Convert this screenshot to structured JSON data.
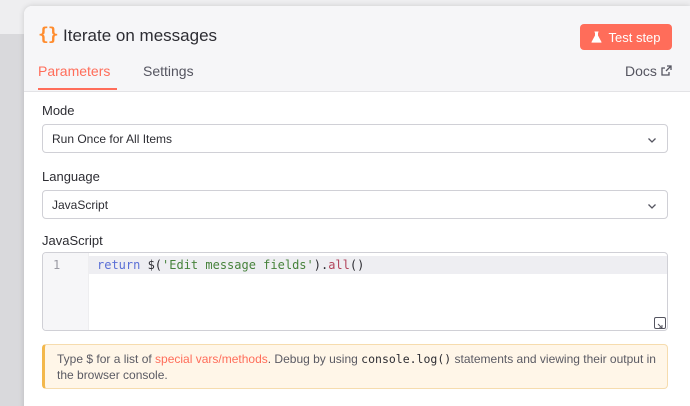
{
  "header": {
    "icon": "braces-icon",
    "icon_glyph": "{}",
    "title": "Iterate on messages",
    "test_step_label": "Test step"
  },
  "tabs": [
    {
      "label": "Parameters",
      "active": true
    },
    {
      "label": "Settings",
      "active": false
    }
  ],
  "docs_label": "Docs",
  "fields": {
    "mode": {
      "label": "Mode",
      "value": "Run Once for All Items"
    },
    "language": {
      "label": "Language",
      "value": "JavaScript"
    },
    "code": {
      "label": "JavaScript",
      "line_number": "1",
      "tokens": {
        "keyword": "return ",
        "fn": "$(",
        "string": "'Edit message fields'",
        "dot": ").",
        "method": "all",
        "parens": "()"
      }
    }
  },
  "hint": {
    "prefix": "Type $ for a list of ",
    "link": "special vars/methods",
    "middle": ". Debug by using ",
    "code": "console.log()",
    "suffix": " statements and viewing their output in the browser console."
  },
  "colors": {
    "accent": "#ff6d5a",
    "icon_orange": "#ff8c2e",
    "hint_bg": "#fff6e8",
    "hint_border": "#f3b84c"
  }
}
